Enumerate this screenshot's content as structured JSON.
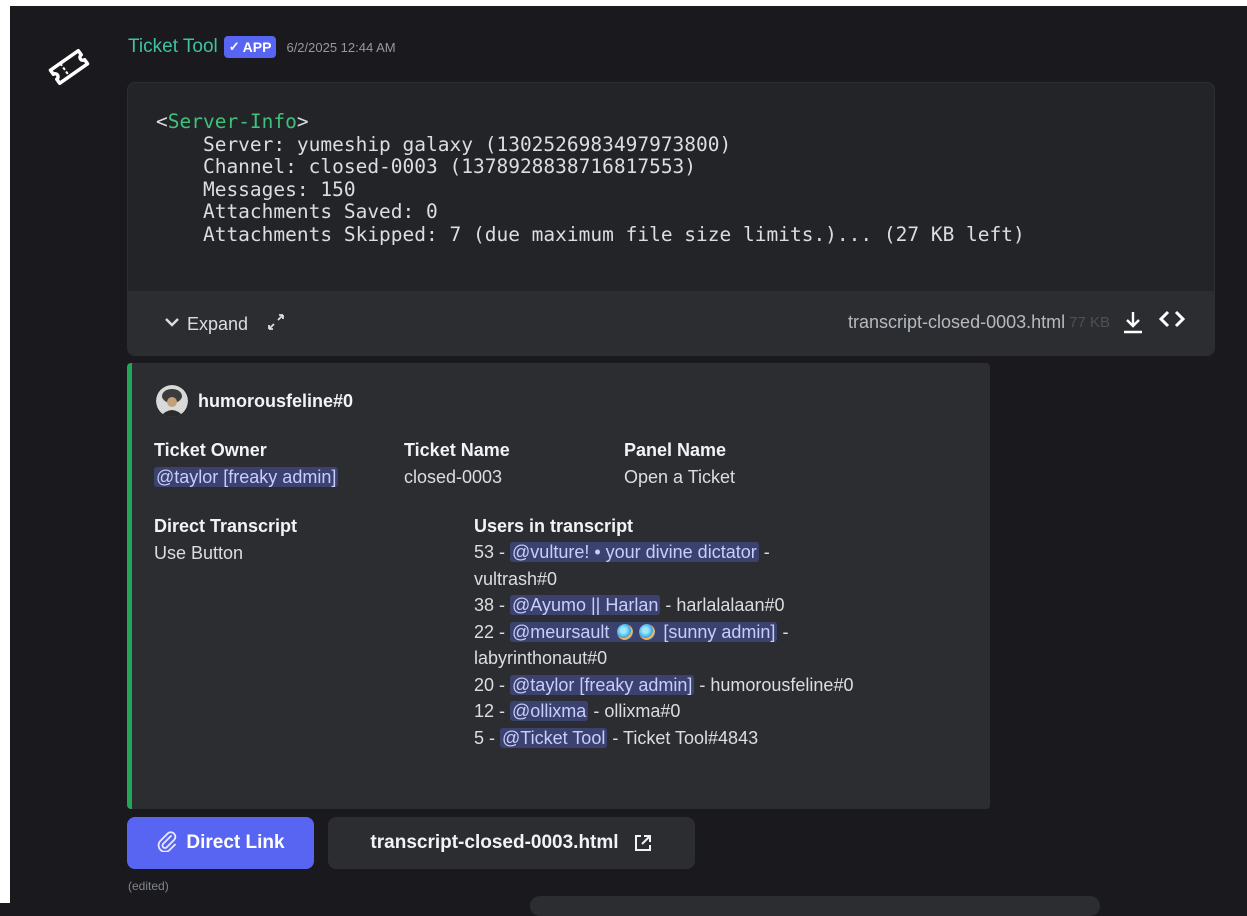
{
  "message": {
    "bot_name": "Ticket Tool",
    "badge_label": "APP",
    "badge_check": "✓",
    "timestamp": "6/2/2025 12:44 AM",
    "edited_label": "(edited)"
  },
  "code_block": {
    "tag_open": "<",
    "tag_name": "Server-Info",
    "tag_close": ">",
    "lines": [
      "    Server: yumeship galaxy (1302526983497973800)",
      "    Channel: closed-0003 (1378928838716817553)",
      "    Messages: 150",
      "    Attachments Saved: 0",
      "    Attachments Skipped: 7 (due maximum file size limits.)... (27 KB left)"
    ],
    "expand_label": "Expand",
    "file_name": "transcript-closed-0003.html",
    "file_size": "77 KB",
    "icons": [
      "chevron-down-icon",
      "expand-arrows-icon",
      "download-icon",
      "code-icon"
    ]
  },
  "embed": {
    "accent_color": "#23a55a",
    "author_name": "humorousfeline#0",
    "fields": {
      "ticket_owner": {
        "name": "Ticket Owner",
        "value": "@taylor [freaky admin]"
      },
      "ticket_name": {
        "name": "Ticket Name",
        "value": "closed-0003"
      },
      "panel_name": {
        "name": "Panel Name",
        "value": "Open a Ticket"
      },
      "direct_transcript": {
        "name": "Direct Transcript",
        "value": "Use Button"
      },
      "users_in_transcript": {
        "name": "Users in transcript",
        "entries": [
          {
            "count": "53 - ",
            "mention": "@vulture! • your divine dictator",
            "suffix": " -",
            "wrap": "vultrash#0"
          },
          {
            "count": "38 - ",
            "mention": "@Ayumo || Harlan",
            "suffix": " - harlalalaan#0"
          },
          {
            "count": "22 - ",
            "mention_a": "@meursault",
            "mention_b": "[sunny admin]",
            "suffix": " -",
            "wrap": "labyrinthonaut#0"
          },
          {
            "count": "20 - ",
            "mention": "@taylor [freaky admin]",
            "suffix": " - humorousfeline#0"
          },
          {
            "count": "12 - ",
            "mention": "@ollixma",
            "suffix": " - ollixma#0"
          },
          {
            "count": "5 - ",
            "mention": "@Ticket Tool",
            "suffix": " - Ticket Tool#4843"
          }
        ]
      }
    }
  },
  "buttons": {
    "direct_link": "Direct Link",
    "file_link": "transcript-closed-0003.html"
  },
  "colors": {
    "brand": "#5865f2",
    "bot_name": "#3fc1a2",
    "mention_bg": "#3c4270",
    "background": "#1a1a1e"
  }
}
